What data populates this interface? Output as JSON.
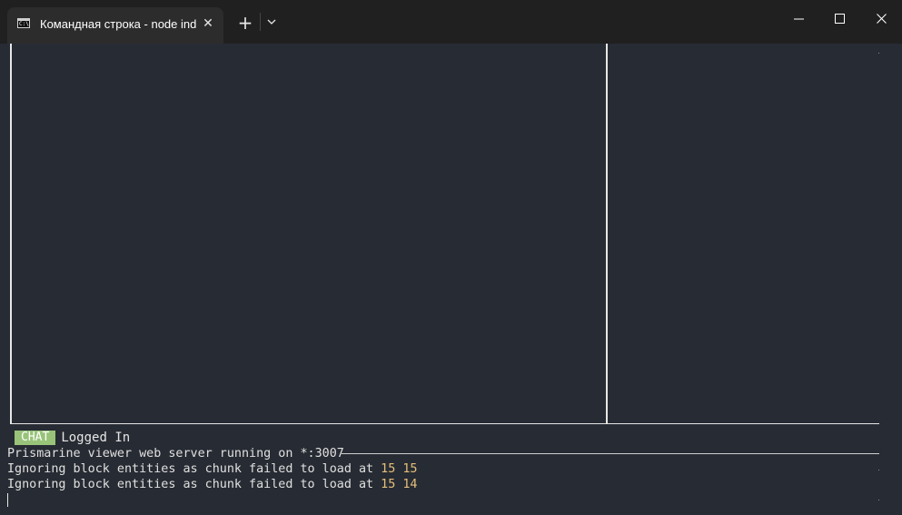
{
  "window": {
    "tab_title": "Командная строка - node  index.js",
    "tab_close_glyph": "✕",
    "new_tab_glyph": "+",
    "tab_icon_text": "C:\\"
  },
  "terminal": {
    "chat_badge": "CHAT",
    "chat_message": "Logged In",
    "log_lines": [
      {
        "text": "Prismarine viewer web server running on *:3007",
        "num1": "",
        "num2": ""
      },
      {
        "text": "Ignoring block entities as chunk failed to load at ",
        "num1": "15",
        "num2": "15"
      },
      {
        "text": "Ignoring block entities as chunk failed to load at ",
        "num1": "15",
        "num2": "14"
      }
    ]
  },
  "colors": {
    "background": "#272b33",
    "titlebar": "#202020",
    "tab": "#2c2c2c",
    "chat_badge": "#98c379",
    "number_highlight": "#e5c07b",
    "border_lines": "#e6e6e6"
  },
  "icons": {
    "tab_icon": "cmd-prompt-icon",
    "minimize": "minimize-icon",
    "maximize": "maximize-icon",
    "close": "close-icon",
    "dropdown": "chevron-down-icon"
  }
}
